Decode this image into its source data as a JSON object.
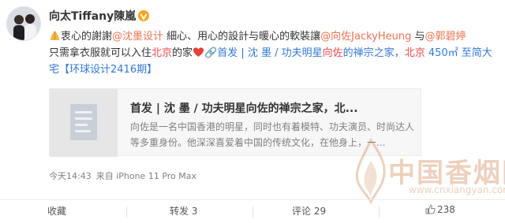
{
  "user": {
    "name": "向太Tiffany陳嵐",
    "verified_icon": "verified-badge-icon"
  },
  "content": {
    "emoji": "praying-hands",
    "seg1": "衷心的謝謝",
    "mention1": "@沈墨设计",
    "seg2": " 細心、用心的設計与暖心的軟裝讓",
    "mention2": "@向佐JackyHeung",
    "seg3": " 与",
    "mention3": "@郭碧婷",
    "seg4": "只需拿衣服就可以入住",
    "city1": "北京",
    "seg5": "的家",
    "heart": "heart",
    "link1": "🔗首发 | 沈 墨 / 功夫明星",
    "link_name": "向佐",
    "link2": "的禅宗之家，",
    "city2": "北京",
    "link3": " 450㎡ 至简大宅【环球设计2416期】"
  },
  "card": {
    "title": "首发 | 沈 墨 / 功夫明星向佐的禅宗之家，北...",
    "desc": "向佐是一名中国香港的明星，同时也有着模特、功夫演员、时尚达人等多重身份。他深深喜爱着中国的传统文化，在他身上，一..."
  },
  "meta": {
    "time": "今天14:43",
    "source": "来自 iPhone 11 Pro Max"
  },
  "actions": {
    "collect": "收藏",
    "repost": "转发 3",
    "comment": "评论 29",
    "like": "238"
  },
  "watermark": {
    "text": "中国香烟网",
    "site": "www.cnxiangyan.com"
  },
  "colors": {
    "mention": "#eb7350",
    "link": "#3478d4",
    "city": "#eb4d4d",
    "muted": "#808080"
  }
}
